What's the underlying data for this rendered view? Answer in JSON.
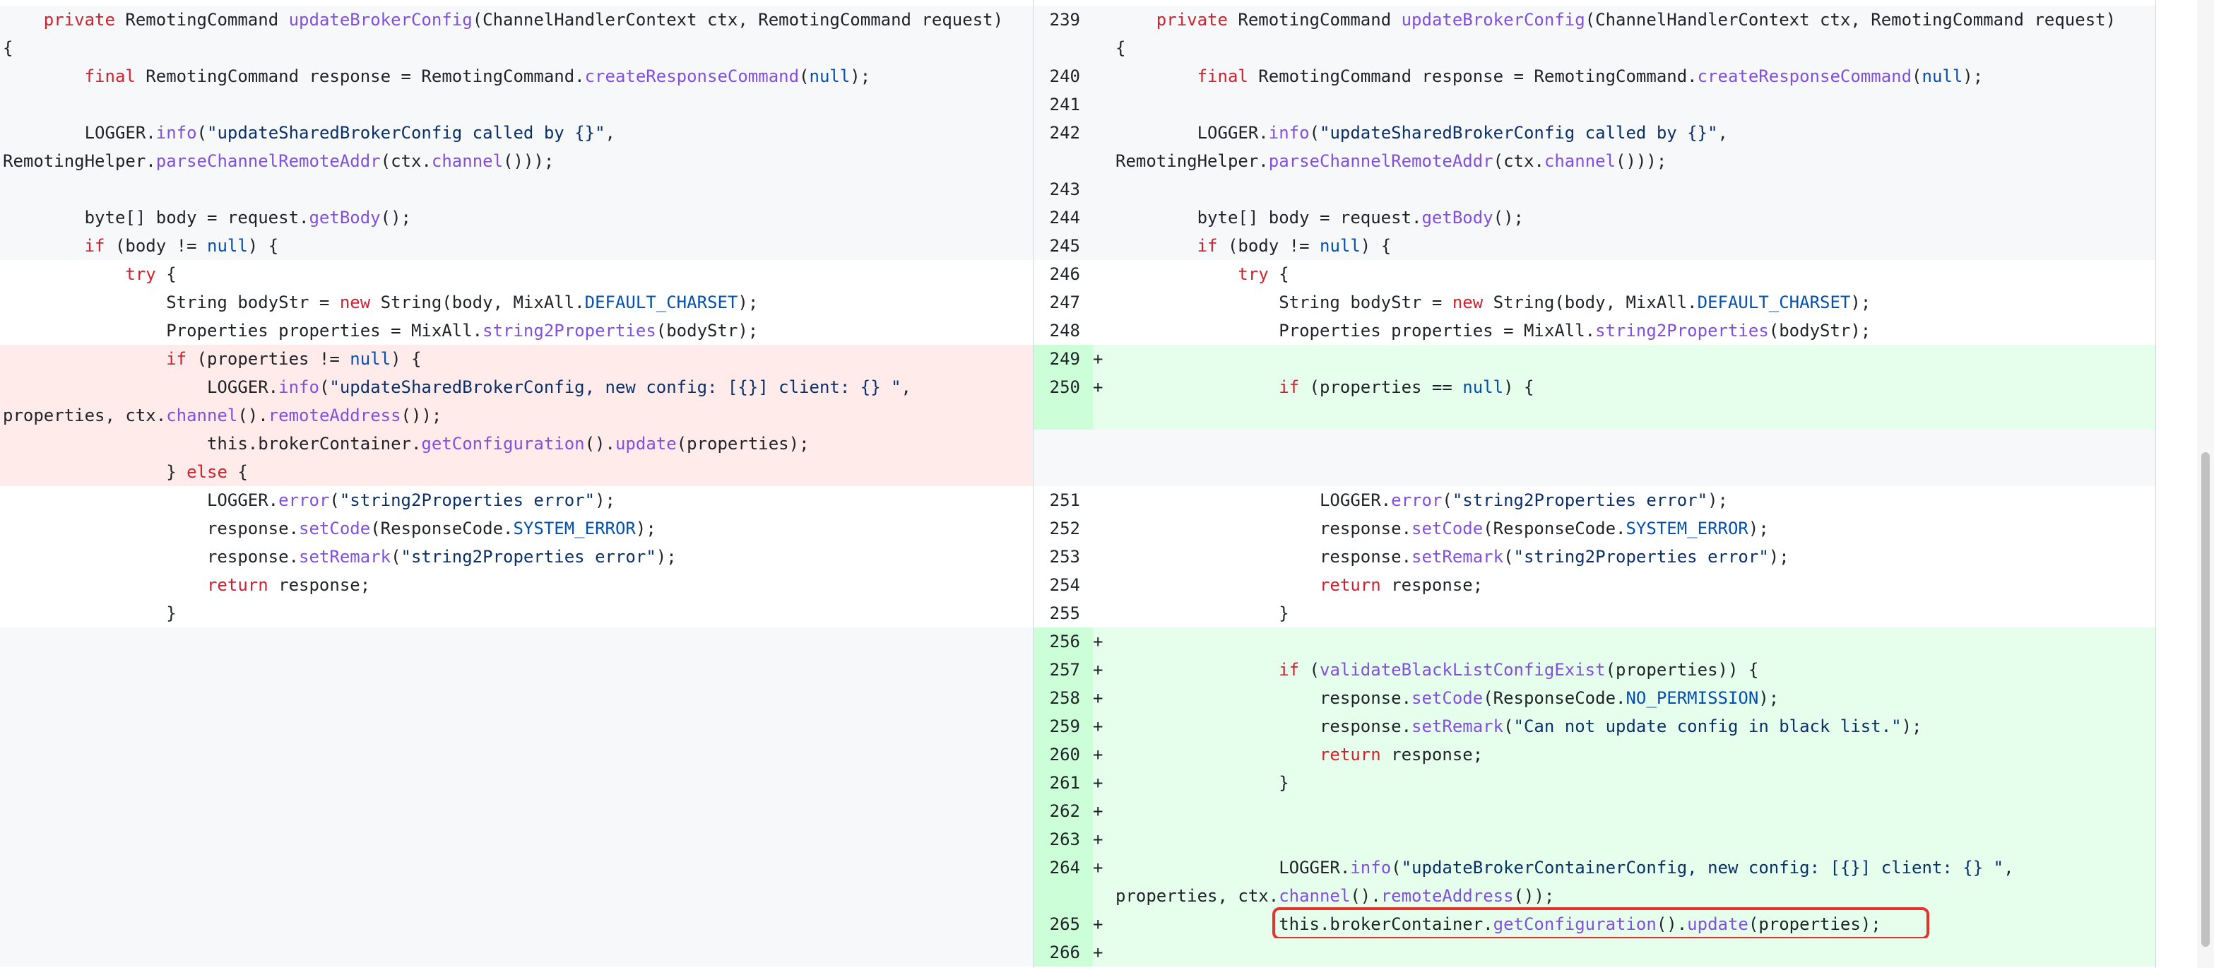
{
  "left_lines": [
    {
      "type": "ctx-gray",
      "indent": 4,
      "tokens": [
        [
          "kw",
          "private"
        ],
        [
          "p",
          " RemotingCommand "
        ],
        [
          "fn",
          "updateBrokerConfig"
        ],
        [
          "p",
          "(ChannelHandlerContext ctx, RemotingCommand request)"
        ]
      ]
    },
    {
      "type": "ctx-gray",
      "indent": 0,
      "tokens": [
        [
          "p",
          "{"
        ]
      ]
    },
    {
      "type": "ctx-gray",
      "indent": 8,
      "tokens": [
        [
          "kw",
          "final"
        ],
        [
          "p",
          " RemotingCommand response = RemotingCommand."
        ],
        [
          "fn",
          "createResponseCommand"
        ],
        [
          "p",
          "("
        ],
        [
          "cst",
          "null"
        ],
        [
          "p",
          ");"
        ]
      ]
    },
    {
      "type": "ctx-gray",
      "indent": 0,
      "tokens": []
    },
    {
      "type": "ctx-gray",
      "indent": 8,
      "tokens": [
        [
          "p",
          "LOGGER."
        ],
        [
          "fn",
          "info"
        ],
        [
          "p",
          "("
        ],
        [
          "str",
          "\"updateSharedBrokerConfig called by {}\""
        ],
        [
          "p",
          ","
        ]
      ]
    },
    {
      "type": "ctx-gray",
      "indent": 0,
      "tokens": [
        [
          "p",
          "RemotingHelper."
        ],
        [
          "fn",
          "parseChannelRemoteAddr"
        ],
        [
          "p",
          "(ctx."
        ],
        [
          "fn",
          "channel"
        ],
        [
          "p",
          "()));"
        ]
      ]
    },
    {
      "type": "ctx-gray",
      "indent": 0,
      "tokens": []
    },
    {
      "type": "ctx-gray",
      "indent": 8,
      "tokens": [
        [
          "p",
          "byte[] body = request."
        ],
        [
          "fn",
          "getBody"
        ],
        [
          "p",
          "();"
        ]
      ]
    },
    {
      "type": "ctx-gray",
      "indent": 8,
      "tokens": [
        [
          "kw",
          "if"
        ],
        [
          "p",
          " (body != "
        ],
        [
          "cst",
          "null"
        ],
        [
          "p",
          ") {"
        ]
      ]
    },
    {
      "type": "ctx-white",
      "indent": 12,
      "tokens": [
        [
          "kw",
          "try"
        ],
        [
          "p",
          " {"
        ]
      ]
    },
    {
      "type": "ctx-white",
      "indent": 16,
      "tokens": [
        [
          "p",
          "String bodyStr = "
        ],
        [
          "kw",
          "new"
        ],
        [
          "p",
          " String(body, MixAll."
        ],
        [
          "cst",
          "DEFAULT_CHARSET"
        ],
        [
          "p",
          ");"
        ]
      ]
    },
    {
      "type": "ctx-white",
      "indent": 16,
      "tokens": [
        [
          "p",
          "Properties properties = MixAll."
        ],
        [
          "fn",
          "string2Properties"
        ],
        [
          "p",
          "(bodyStr);"
        ]
      ]
    },
    {
      "type": "del",
      "indent": 16,
      "tokens": [
        [
          "kw",
          "if"
        ],
        [
          "p",
          " (properties != "
        ],
        [
          "cst",
          "null"
        ],
        [
          "p",
          ") {"
        ]
      ]
    },
    {
      "type": "del",
      "indent": 20,
      "tokens": [
        [
          "p",
          "LOGGER."
        ],
        [
          "fn",
          "info"
        ],
        [
          "p",
          "("
        ],
        [
          "str",
          "\"updateSharedBrokerConfig, new config: [{}] client: {} \""
        ],
        [
          "p",
          ","
        ]
      ]
    },
    {
      "type": "del",
      "indent": 0,
      "tokens": [
        [
          "p",
          "properties, ctx."
        ],
        [
          "fn",
          "channel"
        ],
        [
          "p",
          "()."
        ],
        [
          "fn",
          "remoteAddress"
        ],
        [
          "p",
          "());"
        ]
      ]
    },
    {
      "type": "del",
      "indent": 20,
      "tokens": [
        [
          "p",
          "this.brokerContainer."
        ],
        [
          "fn",
          "getConfiguration"
        ],
        [
          "p",
          "()."
        ],
        [
          "fn",
          "update"
        ],
        [
          "p",
          "(properties);"
        ]
      ]
    },
    {
      "type": "del",
      "indent": 16,
      "tokens": [
        [
          "p",
          "} "
        ],
        [
          "kw",
          "else"
        ],
        [
          "p",
          " {"
        ]
      ]
    },
    {
      "type": "ctx-white",
      "indent": 20,
      "tokens": [
        [
          "p",
          "LOGGER."
        ],
        [
          "fn",
          "error"
        ],
        [
          "p",
          "("
        ],
        [
          "str",
          "\"string2Properties error\""
        ],
        [
          "p",
          ");"
        ]
      ]
    },
    {
      "type": "ctx-white",
      "indent": 20,
      "tokens": [
        [
          "p",
          "response."
        ],
        [
          "fn",
          "setCode"
        ],
        [
          "p",
          "(ResponseCode."
        ],
        [
          "cst",
          "SYSTEM_ERROR"
        ],
        [
          "p",
          ");"
        ]
      ]
    },
    {
      "type": "ctx-white",
      "indent": 20,
      "tokens": [
        [
          "p",
          "response."
        ],
        [
          "fn",
          "setRemark"
        ],
        [
          "p",
          "("
        ],
        [
          "str",
          "\"string2Properties error\""
        ],
        [
          "p",
          ");"
        ]
      ]
    },
    {
      "type": "ctx-white",
      "indent": 20,
      "tokens": [
        [
          "kw",
          "return"
        ],
        [
          "p",
          " response;"
        ]
      ]
    },
    {
      "type": "ctx-white",
      "indent": 16,
      "tokens": [
        [
          "p",
          "}"
        ]
      ]
    },
    {
      "type": "empty",
      "indent": 0,
      "tokens": []
    },
    {
      "type": "empty",
      "indent": 0,
      "tokens": []
    },
    {
      "type": "empty",
      "indent": 0,
      "tokens": []
    },
    {
      "type": "empty",
      "indent": 0,
      "tokens": []
    },
    {
      "type": "empty",
      "indent": 0,
      "tokens": []
    },
    {
      "type": "empty",
      "indent": 0,
      "tokens": []
    },
    {
      "type": "empty",
      "indent": 0,
      "tokens": []
    },
    {
      "type": "empty",
      "indent": 0,
      "tokens": []
    },
    {
      "type": "empty",
      "indent": 0,
      "tokens": []
    },
    {
      "type": "empty",
      "indent": 0,
      "tokens": []
    },
    {
      "type": "empty",
      "indent": 0,
      "tokens": []
    },
    {
      "type": "empty",
      "indent": 0,
      "tokens": []
    }
  ],
  "right_lines": [
    {
      "type": "ctx-gray",
      "num": "239",
      "marker": "",
      "indent": 4,
      "tokens": [
        [
          "kw",
          "private"
        ],
        [
          "p",
          " RemotingCommand "
        ],
        [
          "fn",
          "updateBrokerConfig"
        ],
        [
          "p",
          "(ChannelHandlerContext ctx, RemotingCommand request)"
        ]
      ]
    },
    {
      "type": "ctx-gray",
      "num": "",
      "marker": "",
      "indent": 0,
      "tokens": [
        [
          "p",
          "{"
        ]
      ]
    },
    {
      "type": "ctx-gray",
      "num": "240",
      "marker": "",
      "indent": 8,
      "tokens": [
        [
          "kw",
          "final"
        ],
        [
          "p",
          " RemotingCommand response = RemotingCommand."
        ],
        [
          "fn",
          "createResponseCommand"
        ],
        [
          "p",
          "("
        ],
        [
          "cst",
          "null"
        ],
        [
          "p",
          ");"
        ]
      ]
    },
    {
      "type": "ctx-gray",
      "num": "241",
      "marker": "",
      "indent": 0,
      "tokens": []
    },
    {
      "type": "ctx-gray",
      "num": "242",
      "marker": "",
      "indent": 8,
      "tokens": [
        [
          "p",
          "LOGGER."
        ],
        [
          "fn",
          "info"
        ],
        [
          "p",
          "("
        ],
        [
          "str",
          "\"updateSharedBrokerConfig called by {}\""
        ],
        [
          "p",
          ","
        ]
      ]
    },
    {
      "type": "ctx-gray",
      "num": "",
      "marker": "",
      "indent": 0,
      "tokens": [
        [
          "p",
          "RemotingHelper."
        ],
        [
          "fn",
          "parseChannelRemoteAddr"
        ],
        [
          "p",
          "(ctx."
        ],
        [
          "fn",
          "channel"
        ],
        [
          "p",
          "()));"
        ]
      ]
    },
    {
      "type": "ctx-gray",
      "num": "243",
      "marker": "",
      "indent": 0,
      "tokens": []
    },
    {
      "type": "ctx-gray",
      "num": "244",
      "marker": "",
      "indent": 8,
      "tokens": [
        [
          "p",
          "byte[] body = request."
        ],
        [
          "fn",
          "getBody"
        ],
        [
          "p",
          "();"
        ]
      ]
    },
    {
      "type": "ctx-gray",
      "num": "245",
      "marker": "",
      "indent": 8,
      "tokens": [
        [
          "kw",
          "if"
        ],
        [
          "p",
          " (body != "
        ],
        [
          "cst",
          "null"
        ],
        [
          "p",
          ") {"
        ]
      ]
    },
    {
      "type": "ctx-white",
      "num": "246",
      "marker": "",
      "indent": 12,
      "tokens": [
        [
          "kw",
          "try"
        ],
        [
          "p",
          " {"
        ]
      ]
    },
    {
      "type": "ctx-white",
      "num": "247",
      "marker": "",
      "indent": 16,
      "tokens": [
        [
          "p",
          "String bodyStr = "
        ],
        [
          "kw",
          "new"
        ],
        [
          "p",
          " String(body, MixAll."
        ],
        [
          "cst",
          "DEFAULT_CHARSET"
        ],
        [
          "p",
          ");"
        ]
      ]
    },
    {
      "type": "ctx-white",
      "num": "248",
      "marker": "",
      "indent": 16,
      "tokens": [
        [
          "p",
          "Properties properties = MixAll."
        ],
        [
          "fn",
          "string2Properties"
        ],
        [
          "p",
          "(bodyStr);"
        ]
      ]
    },
    {
      "type": "add",
      "num": "249",
      "marker": "+",
      "indent": 0,
      "tokens": []
    },
    {
      "type": "add",
      "num": "250",
      "marker": "+",
      "indent": 16,
      "tokens": [
        [
          "kw",
          "if"
        ],
        [
          "p",
          " (properties == "
        ],
        [
          "cst",
          "null"
        ],
        [
          "p",
          ") {"
        ]
      ]
    },
    {
      "type": "add-tail",
      "num": "",
      "marker": "",
      "indent": 0,
      "tokens": []
    },
    {
      "type": "empty",
      "num": "",
      "marker": "",
      "indent": 0,
      "tokens": []
    },
    {
      "type": "empty",
      "num": "",
      "marker": "",
      "indent": 0,
      "tokens": []
    },
    {
      "type": "ctx-white",
      "num": "251",
      "marker": "",
      "indent": 20,
      "tokens": [
        [
          "p",
          "LOGGER."
        ],
        [
          "fn",
          "error"
        ],
        [
          "p",
          "("
        ],
        [
          "str",
          "\"string2Properties error\""
        ],
        [
          "p",
          ");"
        ]
      ]
    },
    {
      "type": "ctx-white",
      "num": "252",
      "marker": "",
      "indent": 20,
      "tokens": [
        [
          "p",
          "response."
        ],
        [
          "fn",
          "setCode"
        ],
        [
          "p",
          "(ResponseCode."
        ],
        [
          "cst",
          "SYSTEM_ERROR"
        ],
        [
          "p",
          ");"
        ]
      ]
    },
    {
      "type": "ctx-white",
      "num": "253",
      "marker": "",
      "indent": 20,
      "tokens": [
        [
          "p",
          "response."
        ],
        [
          "fn",
          "setRemark"
        ],
        [
          "p",
          "("
        ],
        [
          "str",
          "\"string2Properties error\""
        ],
        [
          "p",
          ");"
        ]
      ]
    },
    {
      "type": "ctx-white",
      "num": "254",
      "marker": "",
      "indent": 20,
      "tokens": [
        [
          "kw",
          "return"
        ],
        [
          "p",
          " response;"
        ]
      ]
    },
    {
      "type": "ctx-white",
      "num": "255",
      "marker": "",
      "indent": 16,
      "tokens": [
        [
          "p",
          "}"
        ]
      ]
    },
    {
      "type": "add",
      "num": "256",
      "marker": "+",
      "indent": 0,
      "tokens": []
    },
    {
      "type": "add",
      "num": "257",
      "marker": "+",
      "indent": 16,
      "tokens": [
        [
          "kw",
          "if"
        ],
        [
          "p",
          " ("
        ],
        [
          "fn",
          "validateBlackListConfigExist"
        ],
        [
          "p",
          "(properties)) {"
        ]
      ]
    },
    {
      "type": "add",
      "num": "258",
      "marker": "+",
      "indent": 20,
      "tokens": [
        [
          "p",
          "response."
        ],
        [
          "fn",
          "setCode"
        ],
        [
          "p",
          "(ResponseCode."
        ],
        [
          "cst",
          "NO_PERMISSION"
        ],
        [
          "p",
          ");"
        ]
      ]
    },
    {
      "type": "add",
      "num": "259",
      "marker": "+",
      "indent": 20,
      "tokens": [
        [
          "p",
          "response."
        ],
        [
          "fn",
          "setRemark"
        ],
        [
          "p",
          "("
        ],
        [
          "str",
          "\"Can not update config in black list.\""
        ],
        [
          "p",
          ");"
        ]
      ]
    },
    {
      "type": "add",
      "num": "260",
      "marker": "+",
      "indent": 20,
      "tokens": [
        [
          "kw",
          "return"
        ],
        [
          "p",
          " response;"
        ]
      ]
    },
    {
      "type": "add",
      "num": "261",
      "marker": "+",
      "indent": 16,
      "tokens": [
        [
          "p",
          "}"
        ]
      ]
    },
    {
      "type": "add",
      "num": "262",
      "marker": "+",
      "indent": 0,
      "tokens": []
    },
    {
      "type": "add",
      "num": "263",
      "marker": "+",
      "indent": 0,
      "tokens": []
    },
    {
      "type": "add",
      "num": "264",
      "marker": "+",
      "indent": 16,
      "tokens": [
        [
          "p",
          "LOGGER."
        ],
        [
          "fn",
          "info"
        ],
        [
          "p",
          "("
        ],
        [
          "str",
          "\"updateBrokerContainerConfig, new config: [{}] client: {} \""
        ],
        [
          "p",
          ","
        ]
      ]
    },
    {
      "type": "add",
      "num": "",
      "marker": "",
      "indent": 0,
      "tokens": [
        [
          "p",
          "properties, ctx."
        ],
        [
          "fn",
          "channel"
        ],
        [
          "p",
          "()."
        ],
        [
          "fn",
          "remoteAddress"
        ],
        [
          "p",
          "());"
        ]
      ]
    },
    {
      "type": "add",
      "num": "265",
      "marker": "+",
      "indent": 16,
      "tokens": [
        [
          "p",
          "this.brokerContainer."
        ],
        [
          "fn",
          "getConfiguration"
        ],
        [
          "p",
          "()."
        ],
        [
          "fn",
          "update"
        ],
        [
          "p",
          "(properties);"
        ]
      ],
      "highlight": true
    },
    {
      "type": "add",
      "num": "266",
      "marker": "+",
      "indent": 0,
      "tokens": []
    }
  ],
  "colors": {
    "keyword": "#cf222e",
    "function": "#8250df",
    "constant": "#0550ae",
    "string": "#0a3069",
    "deleted_bg": "#ffebe9",
    "added_bg": "#e6ffec",
    "added_num_bg": "#ccffd8",
    "context_bg": "#f6f8fa",
    "highlight_border": "#e5322d"
  }
}
